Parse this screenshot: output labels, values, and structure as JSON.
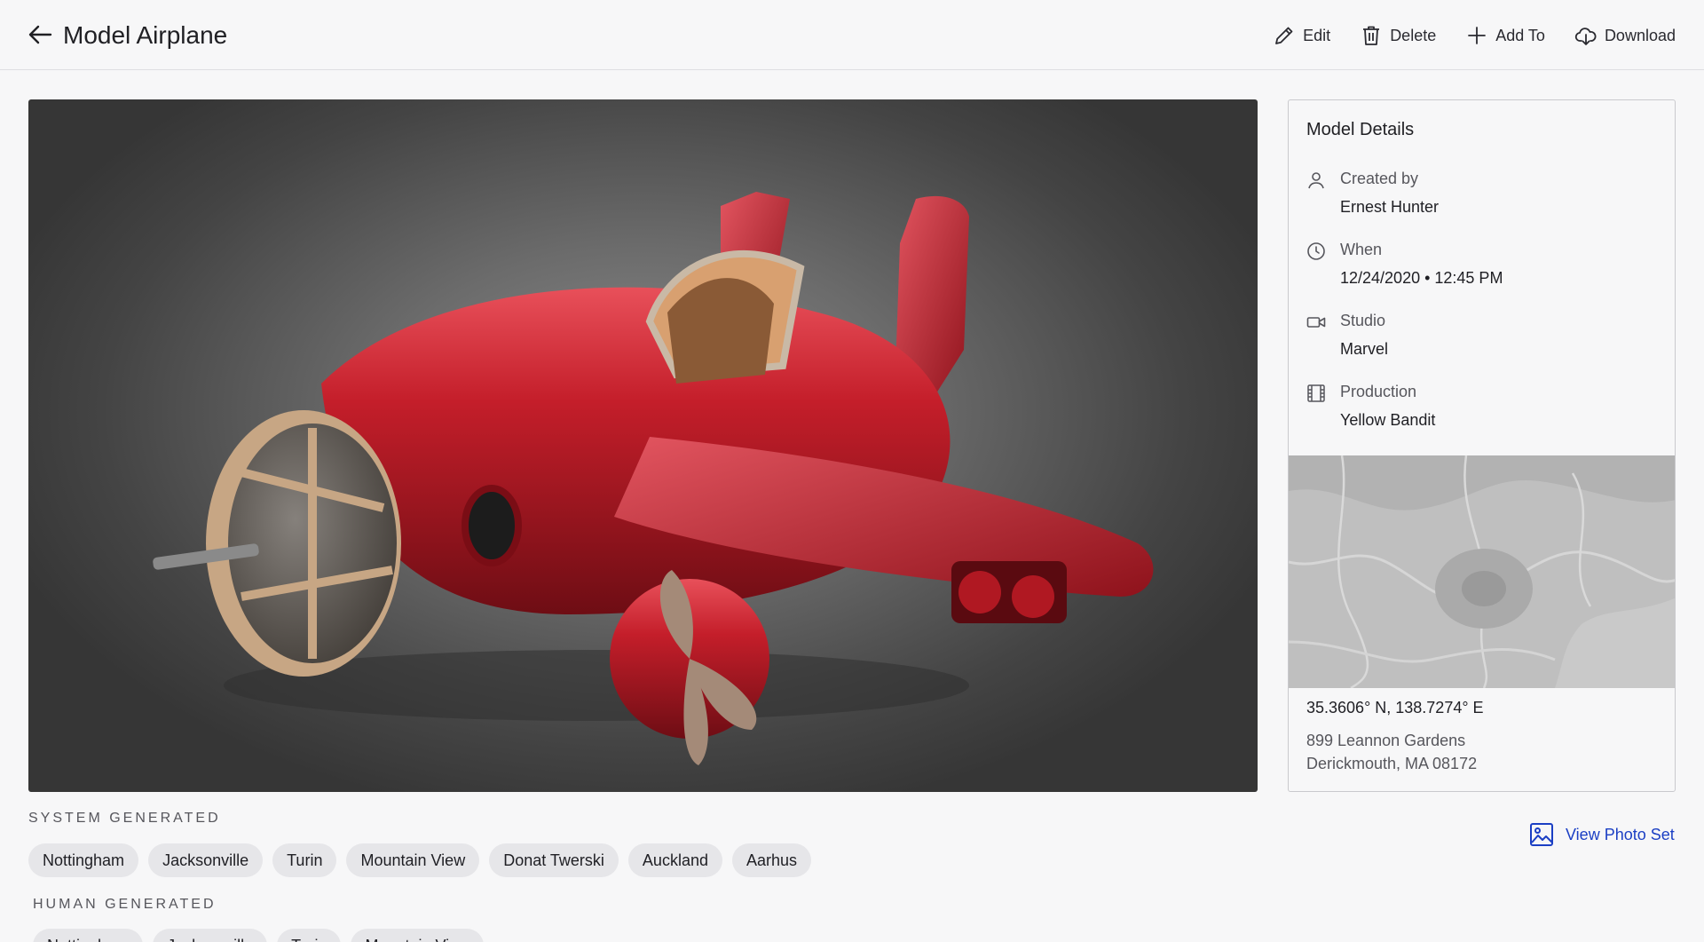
{
  "header": {
    "title": "Model Airplane",
    "actions": [
      {
        "label": "Edit",
        "icon": "pencil-icon"
      },
      {
        "label": "Delete",
        "icon": "trash-icon"
      },
      {
        "label": "Add To",
        "icon": "plus-icon"
      },
      {
        "label": "Download",
        "icon": "cloud-download-icon"
      }
    ]
  },
  "viewer": {
    "subject": "red cartoon propeller airplane 3D render",
    "icon": "airplane-render"
  },
  "details": {
    "title": "Model Details",
    "rows": [
      {
        "label": "Created by",
        "value": "Ernest Hunter",
        "icon": "user-icon"
      },
      {
        "label": "When",
        "value": "12/24/2020 • 12:45 PM",
        "icon": "clock-icon"
      },
      {
        "label": "Studio",
        "value": "Marvel",
        "icon": "video-camera-icon"
      },
      {
        "label": "Production",
        "value": "Yellow Bandit",
        "icon": "film-icon"
      }
    ],
    "coordinates": "35.3606° N, 138.7274° E",
    "address_line1": "899 Leannon Gardens",
    "address_line2": "Derickmouth, MA 08172"
  },
  "system_generated": {
    "heading": "SYSTEM GENERATED",
    "tags": [
      "Nottingham",
      "Jacksonville",
      "Turin",
      "Mountain View",
      "Donat Twerski",
      "Auckland",
      "Aarhus"
    ]
  },
  "human_generated": {
    "heading": "HUMAN GENERATED",
    "tags": [
      "Nottingham",
      "Jacksonville",
      "Turin",
      "Mountain View"
    ]
  },
  "view_photo_set": {
    "label": "View Photo Set",
    "icon": "image-icon"
  },
  "colors": {
    "accent": "#1b3fc4",
    "plane": "#c0202a",
    "chip": "#e6e6e9"
  }
}
